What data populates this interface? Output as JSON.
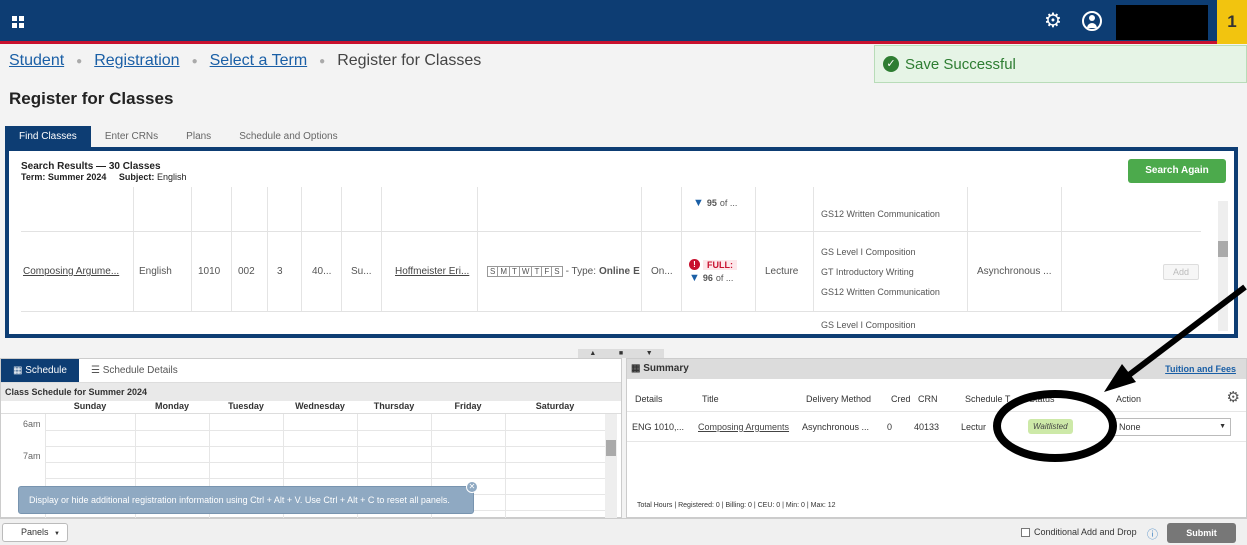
{
  "header": {
    "notification_count": "1",
    "icons": [
      "apps-icon",
      "gear-icon",
      "user-icon"
    ]
  },
  "breadcrumb": {
    "items": [
      "Student",
      "Registration",
      "Select a Term"
    ],
    "current": "Register for Classes"
  },
  "toast": {
    "message": "Save Successful"
  },
  "page": {
    "title": "Register for Classes"
  },
  "tabs": [
    "Find Classes",
    "Enter CRNs",
    "Plans",
    "Schedule and Options"
  ],
  "search_results": {
    "title": "Search Results — 30 Classes",
    "term_label": "Term:",
    "term": "Summer 2024",
    "subject_label": "Subject:",
    "subject": "English",
    "search_again": "Search Again",
    "top_partial": {
      "count": "95",
      "of": "of ...",
      "attribute": "GS12 Written Communication"
    },
    "row": {
      "title": "Composing Argume...",
      "subject": "English",
      "course": "1010",
      "section": "002",
      "hours": "3",
      "crn": "40...",
      "term": "Su...",
      "instructor": "Hoffmeister Eri...",
      "days": [
        "S",
        "M",
        "T",
        "W",
        "T",
        "F",
        "S"
      ],
      "type_label": "- Type:",
      "type": "Online",
      "type_trail": "E",
      "campus": "On...",
      "status": "FULL:",
      "status_count": "96",
      "status_of": "of ...",
      "schedule_type": "Lecture",
      "attributes": [
        "GS Level I Composition",
        "GT Introductory Writing",
        "GS12 Written Communication"
      ],
      "method": "Asynchronous ...",
      "add": "Add"
    },
    "bottom_partial": {
      "attribute": "GS Level I Composition"
    }
  },
  "schedule": {
    "tabs": [
      "Schedule",
      "Schedule Details"
    ],
    "title": "Class Schedule for Summer 2024",
    "days": [
      "Sunday",
      "Monday",
      "Tuesday",
      "Wednesday",
      "Thursday",
      "Friday",
      "Saturday"
    ],
    "hours": [
      "6am",
      "7am"
    ],
    "tooltip": "Display or hide additional registration information using Ctrl + Alt + V. Use Ctrl + Alt + C to reset all panels."
  },
  "summary": {
    "title": "Summary",
    "tuition_link": "Tuition and Fees",
    "columns": [
      "Details",
      "Title",
      "Delivery Method",
      "Cred",
      "CRN",
      "Schedule T",
      "Status",
      "Action"
    ],
    "row": {
      "details": "ENG 1010,...",
      "title": "Composing Arguments",
      "delivery": "Asynchronous ...",
      "cred": "0",
      "crn": "40133",
      "schedule_type": "Lectur",
      "status": "Waitlisted",
      "action": "None"
    },
    "totals": "Total Hours | Registered: 0 | Billing: 0 | CEU: 0 | Min: 0 | Max: 12"
  },
  "footer": {
    "panels": "Panels",
    "conditional": "Conditional Add and Drop",
    "submit": "Submit"
  }
}
